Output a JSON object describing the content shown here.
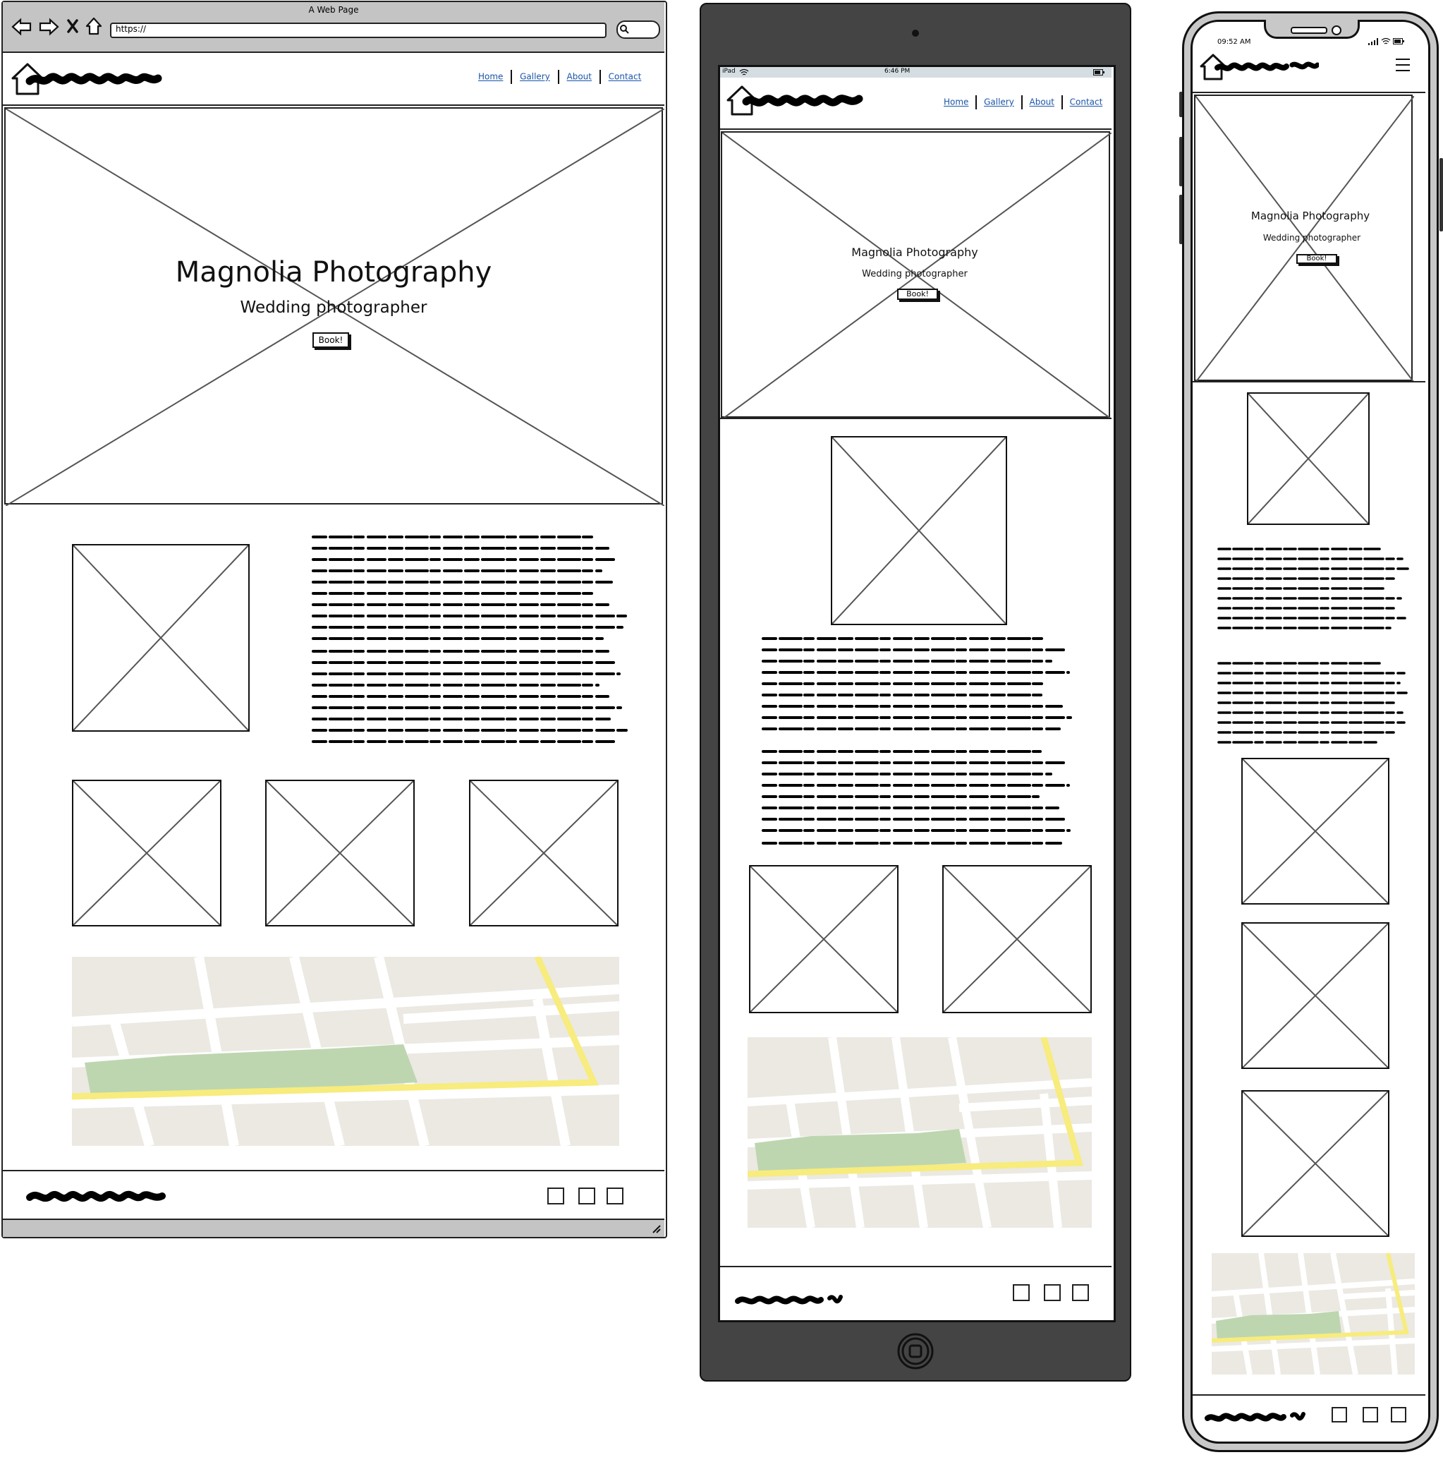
{
  "desktop": {
    "window_title": "A Web Page",
    "url": "https://",
    "nav": [
      "Home",
      "Gallery",
      "About",
      "Contact"
    ],
    "hero_title": "Magnolia Photography",
    "hero_subtitle": "Wedding photographer",
    "hero_button": "Book!"
  },
  "tablet": {
    "status_left": "iPad",
    "status_time": "6:46 PM",
    "nav": [
      "Home",
      "Gallery",
      "About",
      "Contact"
    ],
    "hero_title": "Magnolia Photography",
    "hero_subtitle": "Wedding photographer",
    "hero_button": "Book!"
  },
  "phone": {
    "status_time": "09:52 AM",
    "hero_title": "Magnolia Photography",
    "hero_subtitle": "Wedding photographer",
    "hero_button": "Book!"
  },
  "icons": [
    "back-arrow-icon",
    "forward-arrow-icon",
    "close-icon",
    "home-icon",
    "search-icon",
    "house-logo-icon",
    "hamburger-menu-icon",
    "wifi-icon",
    "battery-icon",
    "signal-icon",
    "resize-grip-icon",
    "home-button-icon"
  ],
  "colors": {
    "map_bg": "#ebe9e2",
    "map_road": "#ffffff",
    "map_highlight_road": "#f7ec7d",
    "map_park": "#bdd6b0",
    "nav_link": "#1a55a8",
    "tablet_frame": "#444444",
    "browser_chrome": "#c4c4c4"
  }
}
